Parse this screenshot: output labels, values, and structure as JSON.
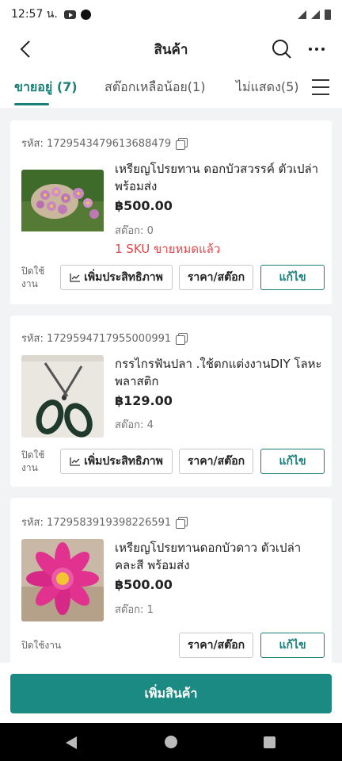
{
  "status_bar": {
    "time": "12:57 น."
  },
  "header": {
    "title": "สินค้า"
  },
  "tabs": [
    {
      "label": "ขายอยู่ (7)"
    },
    {
      "label": "สต๊อกเหลือน้อย(1)"
    },
    {
      "label": "ไม่แสดง(5)"
    }
  ],
  "products": [
    {
      "code": "รหัส: 1729543479613688479",
      "name": "เหรียญโปรยทาน ดอกบัวสวรรค์ ตัวเปล่า พร้อมส่ง",
      "price": "฿500.00",
      "stock": "สต๊อก: 0",
      "soldout": "1 SKU ขายหมดแล้ว",
      "disable_label": "ปิดใช้งาน",
      "boost_label": "เพิ่มประสิทธิภาพ",
      "price_stock_label": "ราคา/สต๊อก",
      "edit_label": "แก้ไข"
    },
    {
      "code": "รหัส: 1729594717955000991",
      "name": "กรรไกรฟันปลา .ใช้ตกแต่งงานDIY โลหะ พลาสติก",
      "price": "฿129.00",
      "stock": "สต๊อก: 4",
      "disable_label": "ปิดใช้งาน",
      "boost_label": "เพิ่มประสิทธิภาพ",
      "price_stock_label": "ราคา/สต๊อก",
      "edit_label": "แก้ไข"
    },
    {
      "code": "รหัส: 1729583919398226591",
      "name": "เหรียญโปรยทานดอกบัวดาว ตัวเปล่า คละสี พร้อมส่ง",
      "price": "฿500.00",
      "stock": "สต๊อก: 1",
      "disable_label": "ปิดใช้งาน",
      "price_stock_label": "ราคา/สต๊อก",
      "edit_label": "แก้ไข"
    }
  ],
  "add_product_label": "เพิ่มสินค้า",
  "colors": {
    "accent": "#1a7f78",
    "primary_button": "#1a8a82",
    "warning": "#e0474a"
  }
}
